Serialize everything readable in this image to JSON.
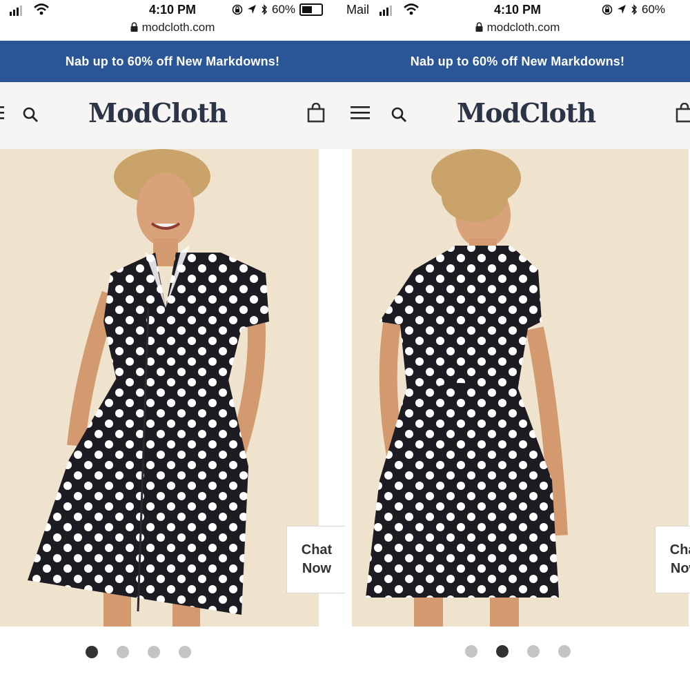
{
  "left_screen": {
    "status": {
      "time": "4:10 PM",
      "url": "modcloth.com",
      "battery": "60%",
      "battery_level": 0.6
    },
    "banner_text": "Nab up to 60% off New Markdowns!",
    "logo": "ModCloth",
    "chat_line1": "Chat",
    "chat_line2": "Now",
    "carousel": {
      "count": 4,
      "active_index": 0
    },
    "icons": [
      "menu-icon",
      "search-icon",
      "shopping-bag-icon",
      "lock-icon",
      "wifi-icon",
      "bluetooth-icon",
      "location-icon",
      "rotation-lock-icon"
    ]
  },
  "right_screen": {
    "status": {
      "carrier": "Mail",
      "time": "4:10 PM",
      "url": "modcloth.com",
      "battery": "60%",
      "battery_level": 0.6
    },
    "banner_text": "Nab up to 60% off New Markdowns!",
    "logo": "ModCloth",
    "chat_line1": "Chat",
    "chat_line2": "Now",
    "carousel": {
      "count": 4,
      "active_index": 1
    },
    "icons": [
      "menu-icon",
      "search-icon",
      "shopping-bag-icon",
      "lock-icon",
      "wifi-icon",
      "bluetooth-icon",
      "location-icon",
      "rotation-lock-icon"
    ]
  },
  "colors": {
    "banner": "#2a5596",
    "header_bg": "#f7f5f3",
    "logo": "#2c3448",
    "photo_bg": "#efe3cd",
    "dress": "#1c1c22",
    "dot_active": "#333333",
    "dot_inactive": "#c4c4c4"
  }
}
